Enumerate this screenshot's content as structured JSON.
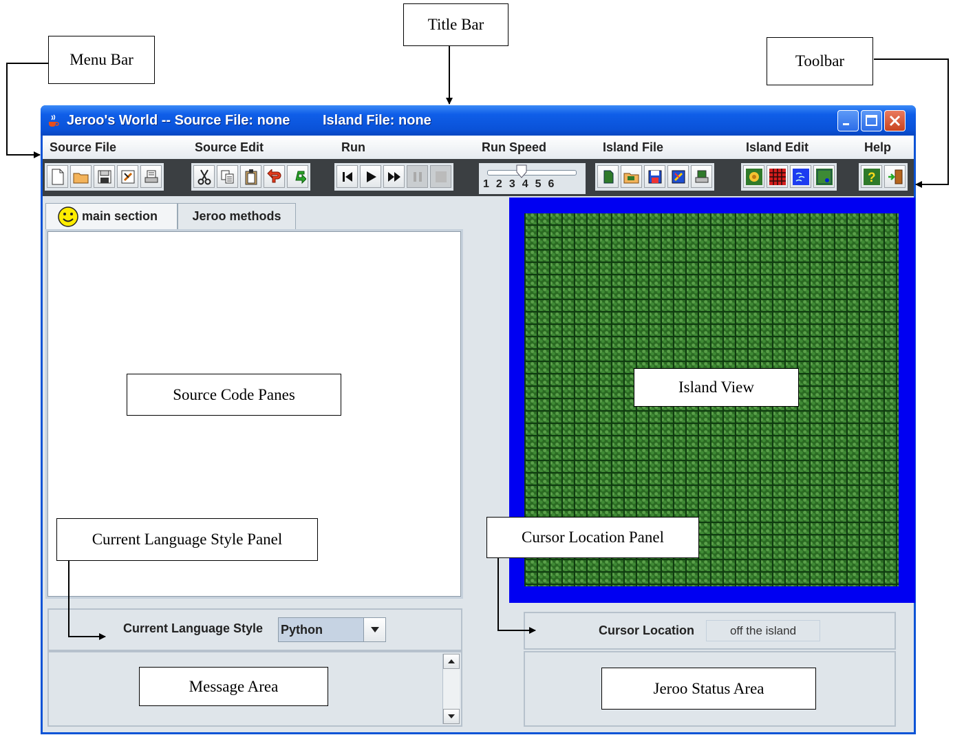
{
  "window": {
    "title": "Jeroo's World -- Source File: none",
    "title_island": "Island File: none"
  },
  "menu": {
    "items": [
      "Source File",
      "Source Edit",
      "Run",
      "Run Speed",
      "Island File",
      "Island Edit",
      "Help"
    ]
  },
  "toolbar": {
    "file_icons": [
      "new-file-icon",
      "open-folder-icon",
      "save-icon",
      "save-as-icon",
      "print-icon"
    ],
    "edit_icons": [
      "cut-icon",
      "copy-icon",
      "paste-icon",
      "undo-icon",
      "redo-icon"
    ],
    "run_icons": [
      "reset-icon",
      "play-icon",
      "fast-forward-icon",
      "pause-icon",
      "stop-icon"
    ],
    "speed": {
      "labels": [
        "1",
        "2",
        "3",
        "4",
        "5",
        "6"
      ],
      "value": 3
    },
    "island_file_icons": [
      "new-island-icon",
      "open-island-icon",
      "save-island-icon",
      "save-island-as-icon",
      "print-island-icon"
    ],
    "island_edit_icons": [
      "flower-icon",
      "net-icon",
      "water-icon",
      "land-icon"
    ],
    "help_icons": [
      "help-icon",
      "exit-icon"
    ]
  },
  "tabs": [
    "main section",
    "Jeroo methods"
  ],
  "language_panel": {
    "label": "Current Language Style",
    "value": "Python"
  },
  "cursor_panel": {
    "label": "Cursor Location",
    "value": "off the island"
  },
  "annotations": {
    "title_bar": "Title Bar",
    "menu_bar": "Menu Bar",
    "toolbar": "Toolbar",
    "source_code_panes": "Source Code Panes",
    "island_view": "Island View",
    "current_language_style_panel": "Current Language Style Panel",
    "cursor_location_panel": "Cursor Location Panel",
    "message_area": "Message Area",
    "jeroo_status_area": "Jeroo Status Area"
  },
  "colors": {
    "titlebar": "#0a52d8",
    "island_water": "#0000f2",
    "grass": "#2a6a22",
    "panel_bg": "#dfe5ea"
  }
}
